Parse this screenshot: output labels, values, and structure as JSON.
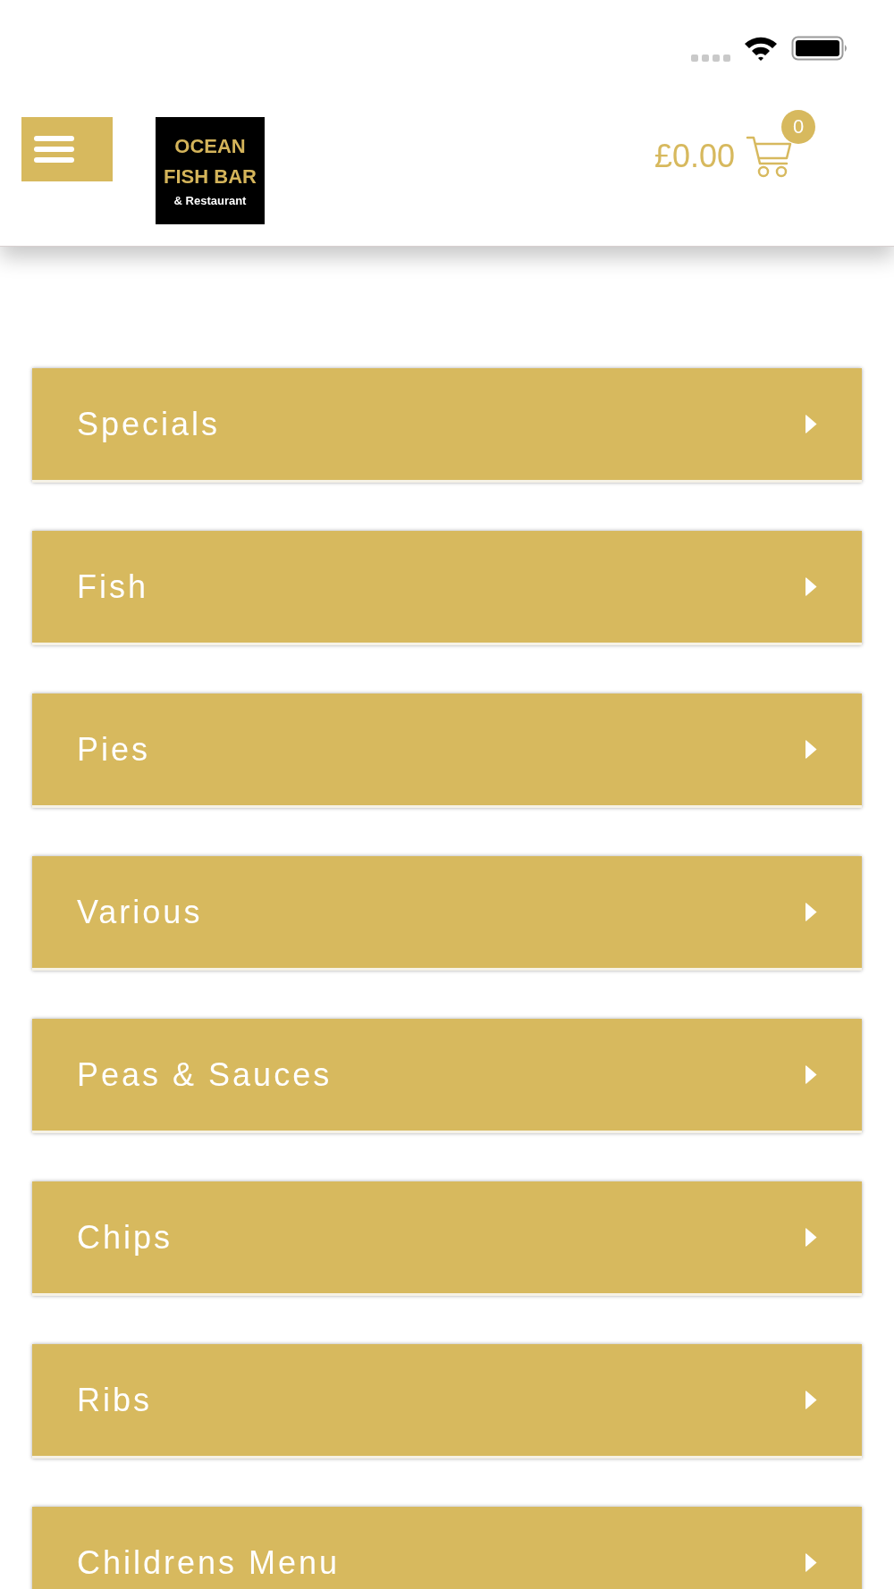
{
  "header": {
    "logo": {
      "lines": [
        "OCEAN",
        "FISH BAR",
        "& Restaurant"
      ]
    },
    "cart": {
      "total": "£0.00",
      "count": "0"
    }
  },
  "menu_categories": [
    {
      "label": "Specials",
      "expanded": false
    },
    {
      "label": "Fish",
      "expanded": false
    },
    {
      "label": "Pies",
      "expanded": false
    },
    {
      "label": "Various",
      "expanded": false
    },
    {
      "label": "Peas & Sauces",
      "expanded": false
    },
    {
      "label": "Chips",
      "expanded": false
    },
    {
      "label": "Ribs",
      "expanded": false
    },
    {
      "label": "Childrens Menu",
      "expanded": false
    }
  ]
}
